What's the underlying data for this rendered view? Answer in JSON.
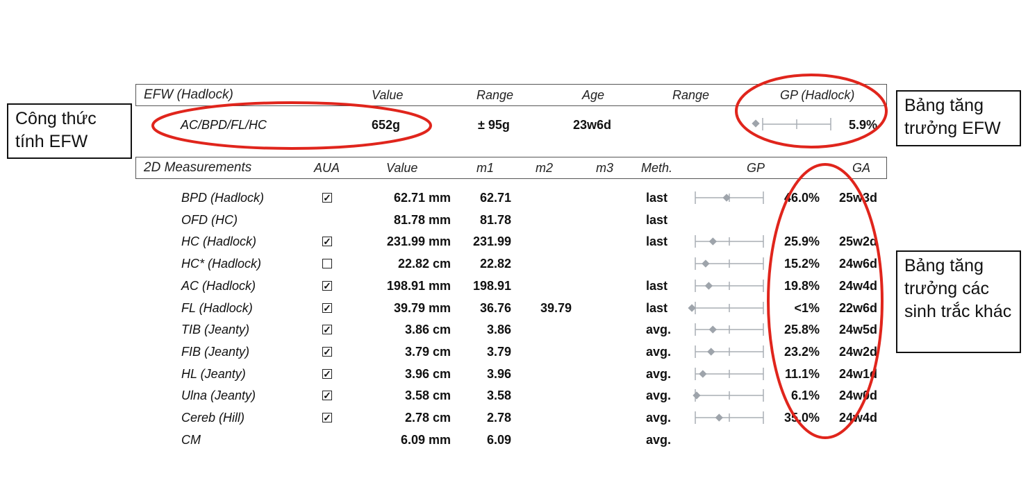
{
  "efw": {
    "headers": {
      "title": "EFW (Hadlock)",
      "value": "Value",
      "range": "Range",
      "age": "Age",
      "range2": "Range",
      "gp": "GP (Hadlock)"
    },
    "row": {
      "formula": "AC/BPD/FL/HC",
      "value": "652g",
      "range": "± 95g",
      "age": "23w6d",
      "gp": "5.9%",
      "gp_fraction": 0.0
    }
  },
  "measurements": {
    "headers": {
      "title": "2D Measurements",
      "aua": "AUA",
      "value": "Value",
      "m1": "m1",
      "m2": "m2",
      "m3": "m3",
      "meth": "Meth.",
      "gp": "GP",
      "ga": "GA"
    },
    "rows": [
      {
        "name": "BPD (Hadlock)",
        "aua": "checked",
        "value": "62.71 mm",
        "m1": "62.71",
        "m2": "",
        "meth": "last",
        "gp": "46.0%",
        "ga": "25w3d",
        "gp_fraction": 0.46
      },
      {
        "name": "OFD (HC)",
        "aua": "none",
        "value": "81.78 mm",
        "m1": "81.78",
        "m2": "",
        "meth": "last",
        "gp": "",
        "ga": ""
      },
      {
        "name": "HC (Hadlock)",
        "aua": "checked",
        "value": "231.99 mm",
        "m1": "231.99",
        "m2": "",
        "meth": "last",
        "gp": "25.9%",
        "ga": "25w2d",
        "gp_fraction": 0.259
      },
      {
        "name": "HC* (Hadlock)",
        "aua": "unchecked",
        "value": "22.82 cm",
        "m1": "22.82",
        "m2": "",
        "meth": "",
        "gp": "15.2%",
        "ga": "24w6d",
        "gp_fraction": 0.152
      },
      {
        "name": "AC (Hadlock)",
        "aua": "checked",
        "value": "198.91 mm",
        "m1": "198.91",
        "m2": "",
        "meth": "last",
        "gp": "19.8%",
        "ga": "24w4d",
        "gp_fraction": 0.198
      },
      {
        "name": "FL (Hadlock)",
        "aua": "checked",
        "value": "39.79 mm",
        "m1": "36.76",
        "m2": "39.79",
        "meth": "last",
        "gp": "<1%",
        "ga": "22w6d",
        "gp_fraction": -0.05
      },
      {
        "name": "TIB (Jeanty)",
        "aua": "checked",
        "value": "3.86 cm",
        "m1": "3.86",
        "m2": "",
        "meth": "avg.",
        "gp": "25.8%",
        "ga": "24w5d",
        "gp_fraction": 0.258
      },
      {
        "name": "FIB (Jeanty)",
        "aua": "checked",
        "value": "3.79 cm",
        "m1": "3.79",
        "m2": "",
        "meth": "avg.",
        "gp": "23.2%",
        "ga": "24w2d",
        "gp_fraction": 0.232
      },
      {
        "name": "HL (Jeanty)",
        "aua": "checked",
        "value": "3.96 cm",
        "m1": "3.96",
        "m2": "",
        "meth": "avg.",
        "gp": "11.1%",
        "ga": "24w1d",
        "gp_fraction": 0.111
      },
      {
        "name": "Ulna (Jeanty)",
        "aua": "checked",
        "value": "3.58 cm",
        "m1": "3.58",
        "m2": "",
        "meth": "avg.",
        "gp": "6.1%",
        "ga": "24w0d",
        "gp_fraction": 0.02
      },
      {
        "name": "Cereb (Hill)",
        "aua": "checked",
        "value": "2.78 cm",
        "m1": "2.78",
        "m2": "",
        "meth": "avg.",
        "gp": "35.0%",
        "ga": "24w4d",
        "gp_fraction": 0.35
      },
      {
        "name": "CM",
        "aua": "none",
        "value": "6.09 mm",
        "m1": "6.09",
        "m2": "",
        "meth": "avg.",
        "gp": "",
        "ga": ""
      }
    ]
  },
  "callouts": {
    "formula": "Công thức tính EFW",
    "efw_growth": "Bảng tăng trưởng EFW",
    "other_growth": "Bảng tăng trưởng các sinh trắc khác"
  },
  "colors": {
    "annotation_red": "#e0251c",
    "marker_gray": "#9ea4ab",
    "line_gray": "#a9aeb4"
  }
}
